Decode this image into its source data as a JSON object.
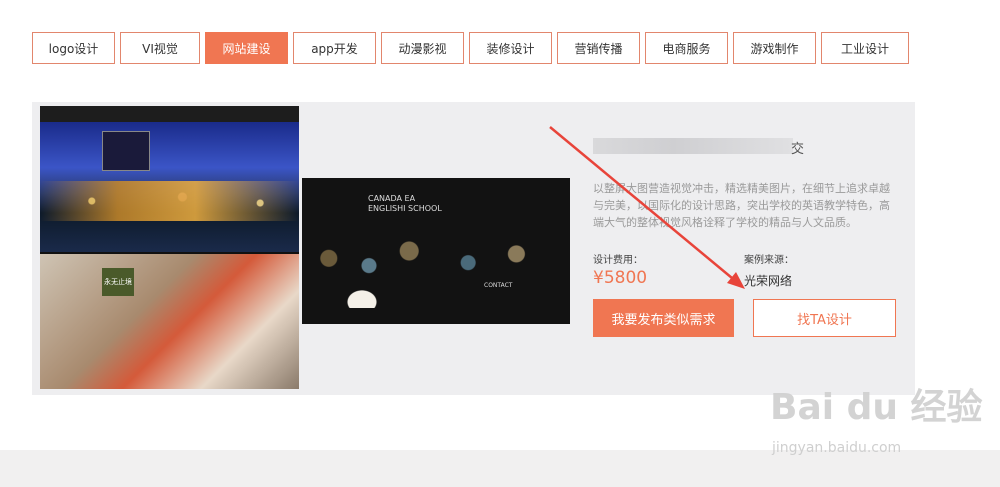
{
  "tabs": [
    {
      "label": "logo设计",
      "active": false
    },
    {
      "label": "VI视觉",
      "active": false
    },
    {
      "label": "网站建设",
      "active": true
    },
    {
      "label": "app开发",
      "active": false
    },
    {
      "label": "动漫影视",
      "active": false
    },
    {
      "label": "装修设计",
      "active": false
    },
    {
      "label": "营销传播",
      "active": false
    },
    {
      "label": "电商服务",
      "active": false
    },
    {
      "label": "游戏制作",
      "active": false
    },
    {
      "label": "工业设计",
      "active": false
    }
  ],
  "case": {
    "shot1_tag": "永无止境",
    "shot2_title_line1": "CANADA EA",
    "shot2_title_line2": "ENGLISHI SCHOOL",
    "shot2_contact": "CONTACT",
    "name_suffix": "交",
    "description": "以整屏大图营造视觉冲击，精选精美图片，在细节上追求卓越与完美，以国际化的设计思路，突出学校的英语教学特色，高端大气的整体视觉风格诠释了学校的精品与人文品质。",
    "fee_label": "设计费用：",
    "price": "¥5800",
    "source_label": "案例来源：",
    "source": "光荣网络"
  },
  "buttons": {
    "publish": "我要发布类似需求",
    "find": "找TA设计"
  },
  "watermark": {
    "brand": "Bai du 经验",
    "url": "jingyan.baidu.com"
  },
  "colors": {
    "accent": "#f07652",
    "card_bg": "#eeeef0",
    "arrow": "#e8443a"
  }
}
